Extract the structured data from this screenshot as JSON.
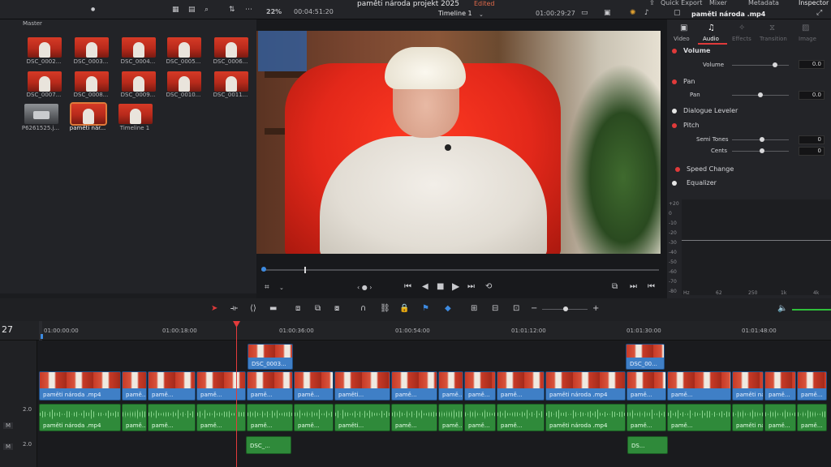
{
  "topbar": {
    "project_title": "paměti národa projekt 2025",
    "edited_badge": "Edited",
    "zoom": "22%",
    "source_timecode": "00:04:51:20",
    "timeline_name": "Timeline 1",
    "record_timecode": "01:00:29:27",
    "quick_export": "Quick Export",
    "mixer": "Mixer",
    "metadata": "Metadata",
    "inspector": "Inspector",
    "clip_name": "paměti národa .mp4"
  },
  "media_pool": {
    "bin": "Master",
    "clips": [
      {
        "label": "DSC_0002..."
      },
      {
        "label": "DSC_0003..."
      },
      {
        "label": "DSC_0004..."
      },
      {
        "label": "DSC_0005..."
      },
      {
        "label": "DSC_0006..."
      },
      {
        "label": "DSC_0007..."
      },
      {
        "label": "DSC_0008..."
      },
      {
        "label": "DSC_0009..."
      },
      {
        "label": "DSC_0010..."
      },
      {
        "label": "DSC_0011..."
      },
      {
        "label": "P6261525.j..."
      },
      {
        "label": "paměti nár..."
      },
      {
        "label": "Timeline 1"
      }
    ]
  },
  "inspector": {
    "tabs": [
      "Video",
      "Audio",
      "Effects",
      "Transition",
      "Image"
    ],
    "volume_section": "Volume",
    "volume_label": "Volume",
    "volume_value": "0.0",
    "pan_section": "Pan",
    "pan_label": "Pan",
    "pan_value": "0.0",
    "dialogue_leveler": "Dialogue Leveler",
    "pitch_section": "Pitch",
    "semi_tones_label": "Semi Tones",
    "semi_tones_value": "0",
    "cents_label": "Cents",
    "cents_value": "0",
    "speed_change": "Speed Change",
    "equalizer": "Equalizer",
    "eq_db_labels": [
      "+20",
      "0",
      "-10",
      "-20",
      "-30",
      "-40",
      "-50",
      "-60",
      "-70",
      "-80"
    ],
    "eq_freq_labels": [
      "Hz",
      "62",
      "250",
      "1k",
      "4k"
    ]
  },
  "timeline": {
    "track_number": "27",
    "ruler_ticks": [
      "01:00:00:00",
      "01:00:18:00",
      "01:00:36:00",
      "01:00:54:00",
      "01:01:12:00",
      "01:01:30:00",
      "01:01:48:00"
    ],
    "video_track_clips": [
      "paměti národa .mp4",
      "pamě...",
      "pamě...",
      "pamě...",
      "pamě...",
      "pamě...",
      "paměti...",
      "pamě...",
      "pamě...",
      "pamě...",
      "pamě...",
      "paměti národa .mp4",
      "pamě...",
      "pamě...",
      "paměti národa .mp4",
      "pamě...",
      "pamě...",
      "paměti národa"
    ],
    "overlay_clip_1": "DSC_0003...",
    "overlay_clip_2": "DSC_00...",
    "audio_track_clips": [
      "paměti národa .mp4",
      "pamě...",
      "pamě...",
      "pamě...",
      "pamě...",
      "pamě...",
      "paměti...",
      "pamě...",
      "pamě...",
      "pamě...",
      "pamě...",
      "paměti národa .mp4",
      "pamě...",
      "pamě...",
      "paměti národa .mp4",
      "pamě...",
      "pamě...",
      "paměti národa"
    ],
    "audio_level_1": "2.0",
    "audio_level_2": "2.0",
    "mute_a1": "M",
    "mute_a2": "M",
    "lower_clip_1": "DSC_...",
    "lower_clip_2": "DS..."
  },
  "colors": {
    "video_clip": "#3f7fc6",
    "audio_clip": "#2f8a3a",
    "playhead": "#e33b3b",
    "accent": "#e03a3a"
  }
}
